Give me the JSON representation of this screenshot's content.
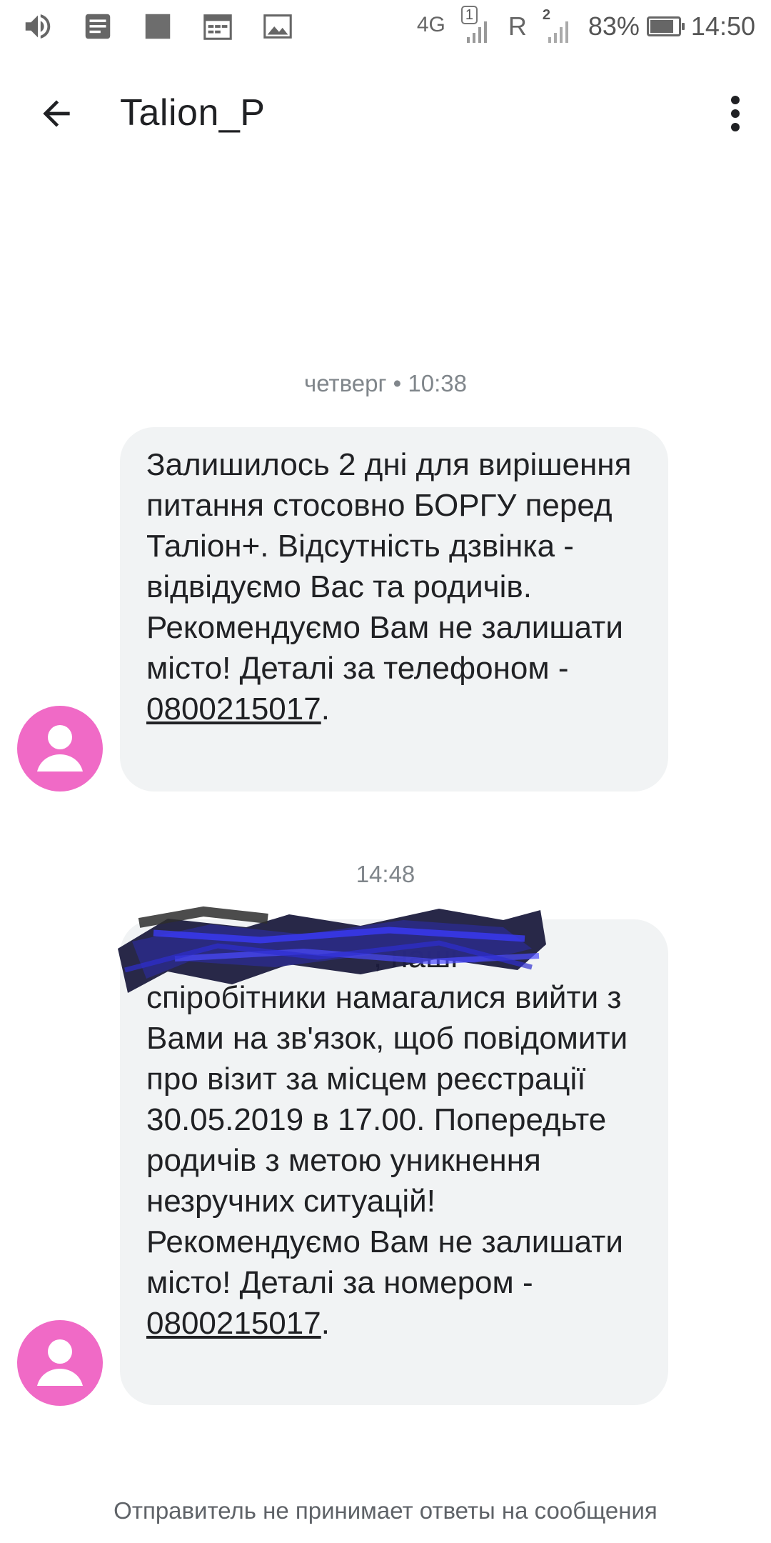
{
  "status_bar": {
    "network": "4G",
    "sim1": "1",
    "roaming": "R",
    "sim2": "2",
    "battery_percent": "83%",
    "battery_level": 0.83,
    "time": "14:50",
    "icons": [
      "volume-icon",
      "notes-icon",
      "app-square-icon",
      "calendar-icon",
      "gallery-icon"
    ]
  },
  "app_bar": {
    "title": "Talion_P",
    "back_icon": "arrow-left-icon",
    "menu_icon": "more-vert-icon"
  },
  "conversation": {
    "messages": [
      {
        "timestamp": "четверг • 10:38",
        "text": "Залишилось 2 дні для вирішення питання стосовно БОРГУ перед Таліон+. Відсутність дзвінка - відвідуємо Вас та родичів. Рекомендуємо Вам не залишати місто! Деталі за телефоном - ",
        "phone": "0800215017",
        "end": "."
      },
      {
        "timestamp": "14:48",
        "text": "                          , наші спіробітники намагалися вийти з Вами на зв'язок, щоб повідомити про візит за місцем реєстрації 30.05.2019 в 17.00. Попередьте родичів з метою уникнення незручних ситуацій! Рекомендуємо Вам не залишати місто! Деталі за номером - ",
        "phone": "0800215017",
        "end": "."
      }
    ]
  },
  "footer": {
    "notice": "Отправитель не принимает ответы на сообщения"
  },
  "colors": {
    "avatar": "#f06ac6",
    "bubble": "#f1f3f4",
    "redaction_dark": "#1a1a4a",
    "redaction_blue": "#3a3ae0"
  }
}
